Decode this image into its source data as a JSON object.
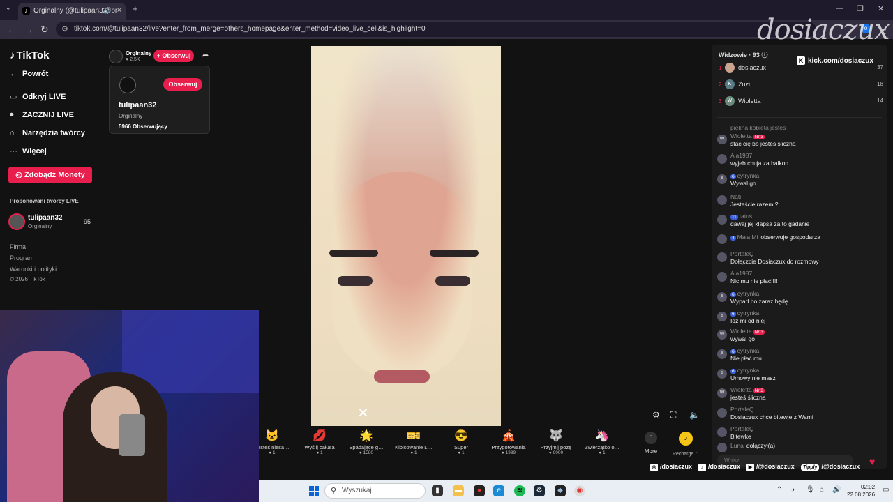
{
  "browser": {
    "tab_title": "Orginalny (@tulipaan32) pr",
    "url": "tiktok.com/@tulipaan32/live?enter_from_merge=others_homepage&enter_method=video_live_cell&is_highlight=0",
    "profile_initial": "o"
  },
  "sidebar": {
    "brand": "TikTok",
    "nav": [
      {
        "icon": "←",
        "label": "Powrót"
      },
      {
        "icon": "▭",
        "label": "Odkryj LIVE"
      },
      {
        "icon": "⏺",
        "label": "ZACZNIJ LIVE"
      },
      {
        "icon": "⌂",
        "label": "Narzędzia twórcy"
      },
      {
        "icon": "···",
        "label": "Więcej"
      }
    ],
    "coins_button": "Zdobądź Monety",
    "suggested_title": "Proponowani twórcy LIVE",
    "suggested_creator": {
      "name": "tulipaan32",
      "nickname": "Orginalny",
      "count": "95"
    },
    "footer": [
      "Firma",
      "Program",
      "Warunki i polityki",
      "© 2026 TikTok"
    ]
  },
  "host": {
    "nickname": "Orginalny",
    "likes": "2.5K",
    "follow_pill": "+ Obserwuj",
    "popup": {
      "follow": "Obserwuj",
      "username": "tulipaan32",
      "nickname": "Orginalny",
      "followers": "5966 Obserwujący"
    }
  },
  "gifts": [
    {
      "name": "Jesteś niesa…",
      "price": "1",
      "icon": "🐱"
    },
    {
      "name": "Wyślij całusa",
      "price": "1",
      "icon": "💋"
    },
    {
      "name": "Spadające g…",
      "price": "1580",
      "icon": "🌟"
    },
    {
      "name": "Kibicowanie L…",
      "price": "1",
      "icon": "🎫"
    },
    {
      "name": "Super",
      "price": "1",
      "icon": "😎"
    },
    {
      "name": "Przygotowania",
      "price": "1999",
      "icon": "🎪"
    },
    {
      "name": "Przyjmij pozę",
      "price": "6000",
      "icon": "🐺"
    },
    {
      "name": "Zwierzątko o…",
      "price": "1",
      "icon": "🦄"
    }
  ],
  "gift_more": "More",
  "recharge": "Recharge",
  "viewers": {
    "title": "Widzowie · 93",
    "top": [
      {
        "rank": "1",
        "name": "dosiaczux",
        "score": "37",
        "initial": ""
      },
      {
        "rank": "2",
        "name": "Zuzi",
        "score": "18",
        "initial": "K"
      },
      {
        "rank": "3",
        "name": "Wioletta",
        "score": "14",
        "initial": "W"
      }
    ]
  },
  "chat": {
    "faded": "piękna kobieta jesteś",
    "messages": [
      {
        "initial": "W",
        "user": "Wioletta",
        "badge": "Nr 3",
        "level": "",
        "text": "stać cię bo jesteś śliczna"
      },
      {
        "initial": "",
        "user": "Ala1987",
        "badge": "",
        "level": "",
        "text": "wyjeb chuja za balkon"
      },
      {
        "initial": "A",
        "user": "cytrynka",
        "badge": "",
        "level": "6",
        "text": "Wywal go"
      },
      {
        "initial": "",
        "user": "Nati",
        "badge": "",
        "level": "",
        "text": "Jesteście razem ?"
      },
      {
        "initial": "",
        "user": "tatuś",
        "badge": "",
        "level": "11",
        "text": "dawaj jej klapsa za to gadanie"
      },
      {
        "initial": "",
        "user": "Mała Mi",
        "badge": "",
        "level": "4",
        "text": "obserwuje gospodarza",
        "inline": true
      },
      {
        "initial": "",
        "user": "PortaleQ",
        "badge": "",
        "level": "",
        "text": "Dołączcie Dosiaczux do rozmowy"
      },
      {
        "initial": "",
        "user": "Ala1987",
        "badge": "",
        "level": "",
        "text": "Nic mu nie płać!!!!"
      },
      {
        "initial": "A",
        "user": "cytrynka",
        "badge": "",
        "level": "6",
        "text": "Wypad bo zaraz będę"
      },
      {
        "initial": "A",
        "user": "cytrynka",
        "badge": "",
        "level": "6",
        "text": "Idź mi od niej"
      },
      {
        "initial": "W",
        "user": "Wioletta",
        "badge": "Nr 3",
        "level": "",
        "text": "wywal go"
      },
      {
        "initial": "A",
        "user": "cytrynka",
        "badge": "",
        "level": "6",
        "text": "Nie płać mu"
      },
      {
        "initial": "A",
        "user": "cytrynka",
        "badge": "",
        "level": "6",
        "text": "Umowy nie masz"
      },
      {
        "initial": "W",
        "user": "Wioletta",
        "badge": "Nr 3",
        "level": "",
        "text": "jesteś śliczna"
      },
      {
        "initial": "",
        "user": "PortaleQ",
        "badge": "",
        "level": "",
        "text": "Dosiaczux chce bitewje z Wami"
      },
      {
        "initial": "",
        "user": "PortaleQ",
        "badge": "",
        "level": "",
        "text": "Bitewke"
      },
      {
        "initial": "",
        "user": "Luna",
        "badge": "",
        "level": "",
        "text": "dołączył(a)",
        "inline": true
      }
    ],
    "input_placeholder": "Wpisz..."
  },
  "overlay": {
    "watermark": "dosiaczux",
    "kick": "kick.com/dosiaczux",
    "socials": [
      {
        "icon": "ig",
        "label": "/dosiaczux"
      },
      {
        "icon": "tt",
        "label": "/dosiaczux"
      },
      {
        "icon": "yt",
        "label": "/@dosiaczux"
      },
      {
        "icon": "Tipply",
        "label": "/@dosiaczux"
      }
    ]
  },
  "taskbar": {
    "search_placeholder": "Wyszukaj",
    "time": "02:02",
    "date": "22.08.2026"
  },
  "colors": {
    "accent": "#e81f4d",
    "background": "#121212",
    "panel": "#1b1b1b"
  }
}
